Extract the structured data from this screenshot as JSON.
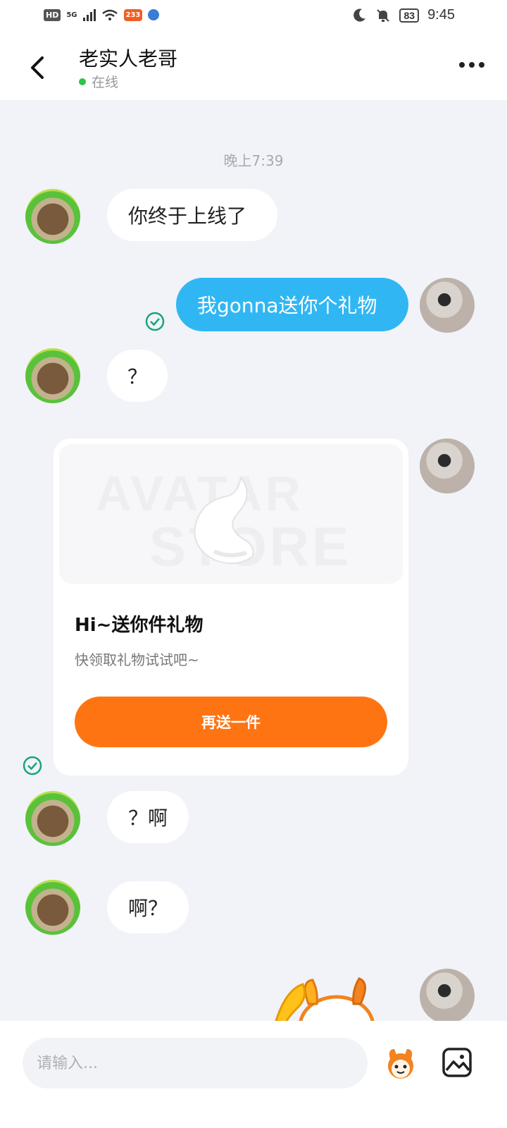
{
  "status_bar": {
    "hd": "HD",
    "network": "5G",
    "app_badge": "233",
    "battery": "83",
    "time": "9:45"
  },
  "header": {
    "title": "老实人老哥",
    "status": "在线"
  },
  "chat": {
    "timestamp": "晚上7:39",
    "messages": [
      {
        "sender": "other",
        "text": "你终于上线了"
      },
      {
        "sender": "me",
        "text": "我gonna送你个礼物"
      },
      {
        "sender": "other",
        "text": "？"
      },
      {
        "sender": "other",
        "text": "？啊"
      },
      {
        "sender": "other",
        "text": "啊？"
      }
    ],
    "gift_card": {
      "watermark_line1": "AVATAR",
      "watermark_line2": "STORE",
      "title": "Hi~送你件礼物",
      "subtitle": "快领取礼物试试吧~",
      "button": "再送一件"
    }
  },
  "input_bar": {
    "placeholder": "请输入..."
  },
  "colors": {
    "my_bubble": "#30b7f3",
    "gift_button": "#ff7412",
    "online_dot": "#2dc44a",
    "read_check": "#1aa37a"
  }
}
